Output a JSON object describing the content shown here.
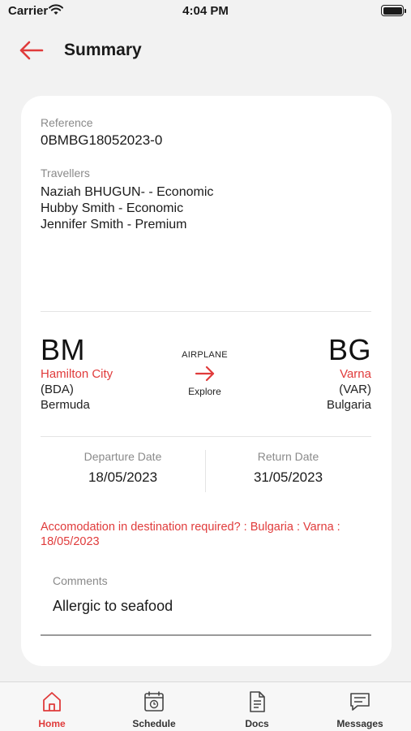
{
  "status_bar": {
    "carrier": "Carrier",
    "time": "4:04 PM"
  },
  "header": {
    "title": "Summary",
    "back_icon": "arrow-left-icon"
  },
  "summary": {
    "reference_label": "Reference",
    "reference_value": "0BMBG18052023-0",
    "travellers_label": "Travellers",
    "travellers": [
      "Naziah BHUGUN- - Economic",
      "Hubby Smith - Economic",
      "Jennifer Smith - Premium"
    ]
  },
  "route": {
    "origin": {
      "code": "BM",
      "city": "Hamilton City",
      "airport": "(BDA)",
      "country": "Bermuda"
    },
    "destination": {
      "code": "BG",
      "city": "Varna",
      "airport": "(VAR)",
      "country": "Bulgaria"
    },
    "transport": "AIRPLANE",
    "explore_label": "Explore"
  },
  "dates": {
    "departure_label": "Departure Date",
    "departure_value": "18/05/2023",
    "return_label": "Return Date",
    "return_value": "31/05/2023"
  },
  "accommodation_note": "Accomodation in destination required? : Bulgaria : Varna : 18/05/2023",
  "comments": {
    "label": "Comments",
    "value": "Allergic to seafood"
  },
  "tabbar": {
    "tabs": [
      {
        "label": "Home",
        "icon": "home-icon",
        "active": true
      },
      {
        "label": "Schedule",
        "icon": "calendar-icon",
        "active": false
      },
      {
        "label": "Docs",
        "icon": "document-icon",
        "active": false
      },
      {
        "label": "Messages",
        "icon": "message-icon",
        "active": false
      }
    ]
  },
  "colors": {
    "accent": "#e03b3b",
    "background": "#f2f2f2",
    "card": "#ffffff"
  }
}
